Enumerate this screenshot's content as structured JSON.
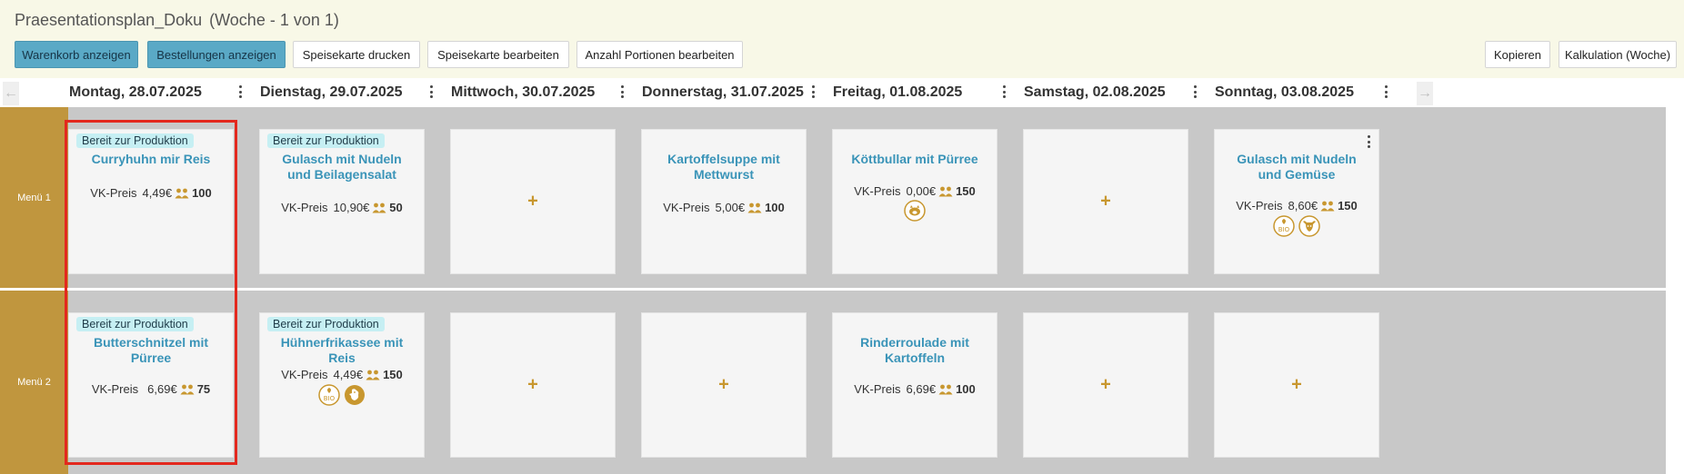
{
  "header": {
    "title": "Praesentationsplan_Doku",
    "subtitle": "(Woche - 1 von 1)"
  },
  "toolbar": {
    "cart": "Warenkorb anzeigen",
    "orders": "Bestellungen anzeigen",
    "print_menu": "Speisekarte drucken",
    "edit_menu": "Speisekarte bearbeiten",
    "edit_portions": "Anzahl Portionen bearbeiten",
    "copy": "Kopieren",
    "calculation": "Kalkulation (Woche)"
  },
  "nav": {
    "prev_icon": "arrow-left-icon",
    "next_icon": "arrow-right-icon"
  },
  "days": [
    "Montag, 28.07.2025",
    "Dienstag, 29.07.2025",
    "Mittwoch, 30.07.2025",
    "Donnerstag, 31.07.2025",
    "Freitag, 01.08.2025",
    "Samstag, 02.08.2025",
    "Sonntag, 03.08.2025"
  ],
  "menus": [
    "Menü 1",
    "Menü 2"
  ],
  "labels": {
    "badge": "Bereit zur Produktion",
    "price_prefix": "VK-Preis",
    "add": "+",
    "bio": "BIO"
  },
  "colors": {
    "accent": "#c8972f",
    "link": "#3a94b8",
    "menu_bg": "#c0963e",
    "badge_bg": "#c6eff3",
    "highlight": "#e3281e",
    "primary_button": "#5aa9c6"
  },
  "cells": {
    "m1": [
      {
        "badge": true,
        "dish": "Curryhuhn mir Reis",
        "price": "4,49€",
        "portions": "100",
        "icons": []
      },
      {
        "badge": true,
        "dish": "Gulasch mit Nudeln und Beilagensalat",
        "price": "10,90€",
        "portions": "50",
        "icons": []
      },
      {
        "empty": true
      },
      {
        "badge": false,
        "dish": "Kartoffelsuppe mit Mettwurst",
        "price": "5,00€",
        "portions": "100",
        "icons": []
      },
      {
        "badge": false,
        "dish": "Köttbullar mit Pürree",
        "price": "0,00€",
        "portions": "150",
        "icons": [
          "pig-icon"
        ]
      },
      {
        "empty": true
      },
      {
        "badge": false,
        "dish": "Gulasch mit Nudeln und Gemüse",
        "price": "8,60€",
        "portions": "150",
        "icons": [
          "bio-icon",
          "cow-icon"
        ],
        "menu": true
      }
    ],
    "m2": [
      {
        "badge": true,
        "dish": "Butterschnitzel mit Pürree",
        "price": "6,69€",
        "portions": "75",
        "icons": []
      },
      {
        "badge": true,
        "dish": "Hühnerfrikassee mit Reis",
        "price": "4,49€",
        "portions": "150",
        "icons": [
          "bio-icon",
          "chicken-icon"
        ]
      },
      {
        "empty": true
      },
      {
        "empty": true
      },
      {
        "badge": false,
        "dish": "Rinderroulade mit Kartoffeln",
        "price": "6,69€",
        "portions": "100",
        "icons": []
      },
      {
        "empty": true
      },
      {
        "empty": true
      }
    ]
  }
}
